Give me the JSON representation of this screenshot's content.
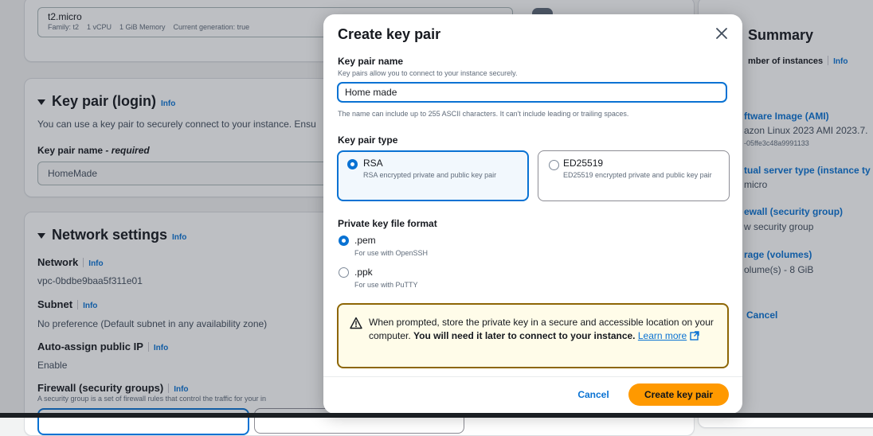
{
  "instance": {
    "type_name": "t2.micro",
    "type_meta": "Family: t2    1 vCPU    1 GiB Memory    Current generation: true"
  },
  "key_pair_section": {
    "heading": "Key pair (login)",
    "info": "Info",
    "description": "You can use a key pair to securely connect to your instance. Ensu",
    "field_label": "Key pair name",
    "field_required": " - required",
    "field_value": "HomeMade"
  },
  "network_section": {
    "heading": "Network settings",
    "info": "Info",
    "network_label": "Network",
    "network_value": "vpc-0bdbe9baa5f311e01",
    "subnet_label": "Subnet",
    "subnet_value": "No preference (Default subnet in any availability zone)",
    "public_ip_label": "Auto-assign public IP",
    "public_ip_value": "Enable",
    "firewall_label": "Firewall (security groups)",
    "firewall_desc": "A security group is a set of firewall rules that control the traffic for your in"
  },
  "summary": {
    "heading": "Summary",
    "instances_label": "mber of instances",
    "info": "Info",
    "ami_label": "ftware Image (AMI)",
    "ami_value": "azon Linux 2023 AMI 2023.7.",
    "ami_id": "-05ffe3c48a9991133",
    "server_label": "tual server type (instance ty",
    "server_value": "micro",
    "firewall_label": "ewall (security group)",
    "firewall_value": "w security group",
    "storage_label": "rage (volumes)",
    "storage_value": "olume(s) - 8 GiB",
    "cancel": "Cancel"
  },
  "modal": {
    "title": "Create key pair",
    "name_label": "Key pair name",
    "name_desc": "Key pairs allow you to connect to your instance securely.",
    "name_value": "Home made",
    "name_hint": "The name can include up to 255 ASCII characters. It can't include leading or trailing spaces.",
    "type_label": "Key pair type",
    "types": [
      {
        "title": "RSA",
        "desc": "RSA encrypted private and public key pair",
        "selected": true
      },
      {
        "title": "ED25519",
        "desc": "ED25519 encrypted private and public key pair",
        "selected": false
      }
    ],
    "format_label": "Private key file format",
    "formats": [
      {
        "title": ".pem",
        "desc": "For use with OpenSSH",
        "selected": true
      },
      {
        "title": ".ppk",
        "desc": "For use with PuTTY",
        "selected": false
      }
    ],
    "alert_text_1": "When prompted, store the private key in a secure and accessible location on your computer. ",
    "alert_text_bold": "You will need it later to connect to your instance.",
    "alert_link": "Learn more",
    "cancel": "Cancel",
    "create": "Create key pair"
  },
  "colors": {
    "accent": "#0972d3",
    "primary_button": "#ff9900",
    "warning_border": "#8d6605",
    "warning_bg": "#fffce9"
  }
}
